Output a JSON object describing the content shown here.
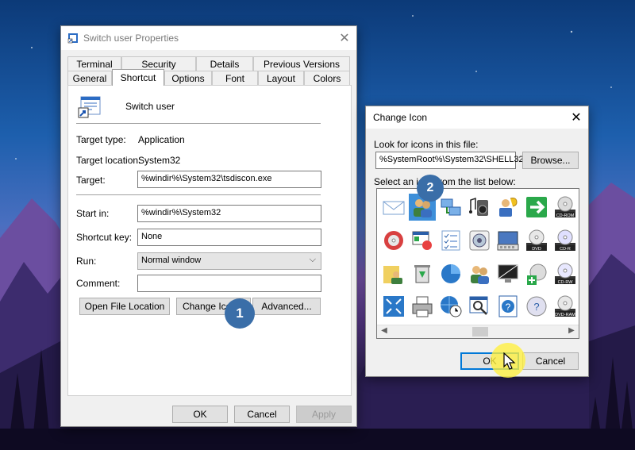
{
  "properties_window": {
    "title": "Switch user Properties",
    "tabs_row1": [
      "Terminal",
      "Security",
      "Details",
      "Previous Versions"
    ],
    "tabs_row2": [
      "General",
      "Shortcut",
      "Options",
      "Font",
      "Layout",
      "Colors"
    ],
    "active_tab": "Shortcut",
    "shortcut_name": "Switch user",
    "target_type_label": "Target type:",
    "target_type_value": "Application",
    "target_location_label": "Target location:",
    "target_location_value": "System32",
    "target_label": "Target:",
    "target_value": "%windir%\\System32\\tsdiscon.exe",
    "start_in_label": "Start in:",
    "start_in_value": "%windir%\\System32",
    "shortcut_key_label": "Shortcut key:",
    "shortcut_key_value": "None",
    "run_label": "Run:",
    "run_value": "Normal window",
    "comment_label": "Comment:",
    "comment_value": "",
    "open_file_location": "Open File Location",
    "change_icon": "Change Icon...",
    "advanced": "Advanced...",
    "ok": "OK",
    "cancel": "Cancel",
    "apply": "Apply"
  },
  "change_icon_dialog": {
    "title": "Change Icon",
    "look_for_label": "Look for icons in this file:",
    "file_path": "%SystemRoot%\\System32\\SHELL32",
    "browse": "Browse...",
    "select_label": "Select an icon from the list below:",
    "ok": "OK",
    "cancel": "Cancel",
    "icons": [
      [
        "envelope",
        "users",
        "network",
        "music",
        "help-user",
        "go-arrow",
        "cd-rom",
        "disc"
      ],
      [
        "disc-red",
        "programs",
        "checklist",
        "gear-disk",
        "keyboard",
        "dvd-drive",
        "cd-r",
        "more"
      ],
      [
        "folder-users",
        "recycle",
        "pie-chart",
        "two-users",
        "monitor",
        "add-disc",
        "cd-rw",
        "cube"
      ],
      [
        "fullscreen",
        "printer",
        "globe-clock",
        "search-window",
        "help",
        "question-disc",
        "dvd-ram",
        "ram"
      ]
    ],
    "icon_labels": {
      "cd-rom": "CD-ROM",
      "cd-r": "CD-R",
      "cd-rw": "CD-RW",
      "dvd-ram": "DVD-RAM",
      "dvd-drive": "DVD"
    },
    "selected_index": [
      0,
      1
    ]
  },
  "annotations": {
    "step1": "1",
    "step2": "2"
  }
}
